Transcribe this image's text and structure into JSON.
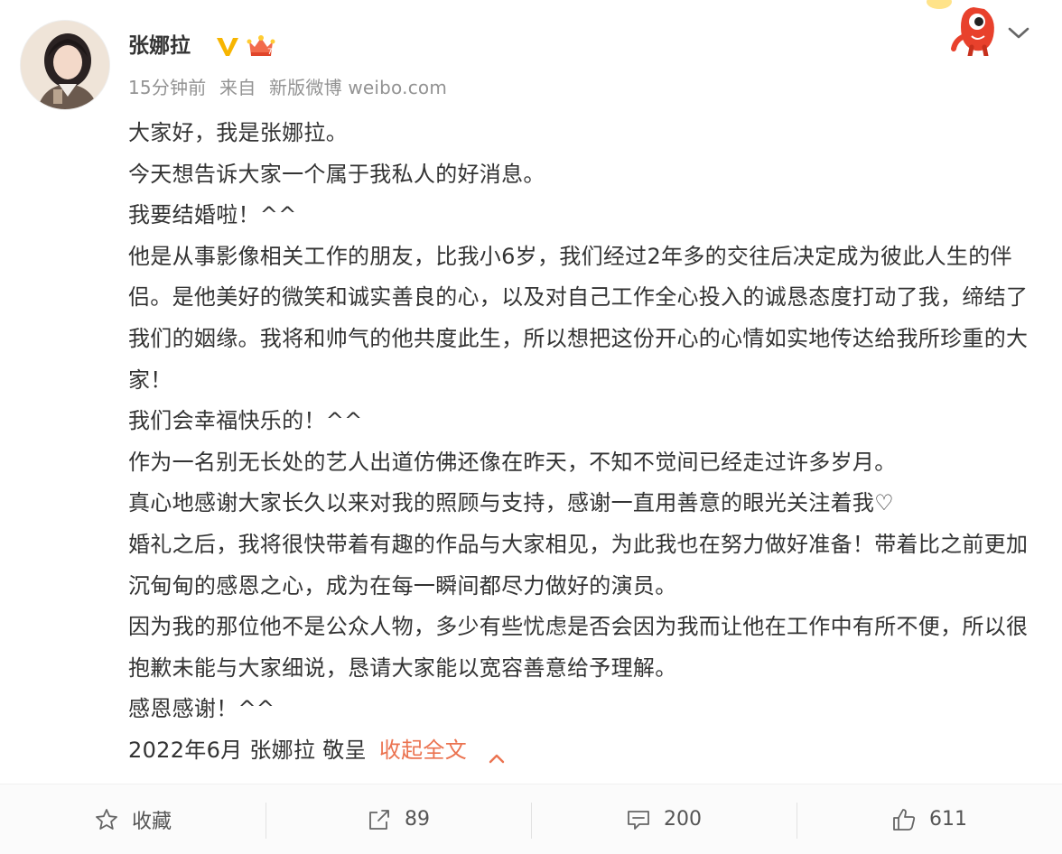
{
  "user": {
    "name": "张娜拉",
    "verified": true,
    "badge": "crown-badge"
  },
  "meta": {
    "time": "15分钟前",
    "source_prefix": "来自",
    "source": "新版微博 weibo.com"
  },
  "post": {
    "paragraphs": [
      "大家好，我是张娜拉。",
      "今天想告诉大家一个属于我私人的好消息。",
      "我要结婚啦！^^",
      "他是从事影像相关工作的朋友，比我小6岁，我们经过2年多的交往后决定成为彼此人生的伴侣。是他美好的微笑和诚实善良的心，以及对自己工作全心投入的诚恳态度打动了我，缔结了我们的姻缘。我将和帅气的他共度此生，所以想把这份开心的心情如实地传达给我所珍重的大家！",
      "我们会幸福快乐的！^^",
      "作为一名别无长处的艺人出道仿佛还像在昨天，不知不觉间已经走过许多岁月。",
      "真心地感谢大家长久以来对我的照顾与支持，感谢一直用善意的眼光关注着我♡",
      "婚礼之后，我将很快带着有趣的作品与大家相见，为此我也在努力做好准备！带着比之前更加沉甸甸的感恩之心，成为在每一瞬间都尽力做好的演员。",
      "因为我的那位他不是公众人物，多少有些忧虑是否会因为我而让他在工作中有所不便，所以很抱歉未能与大家细说，恳请大家能以宽容善意给予理解。",
      "感恩感谢！^^"
    ],
    "signature": "2022年6月 张娜拉 敬呈",
    "collapse_label": "收起全文"
  },
  "actions": {
    "favorite_label": "收藏",
    "repost_count": "89",
    "comment_count": "200",
    "like_count": "611"
  },
  "colors": {
    "text": "#333333",
    "meta": "#939393",
    "link": "#eb7350",
    "verified": "#f7b500"
  }
}
